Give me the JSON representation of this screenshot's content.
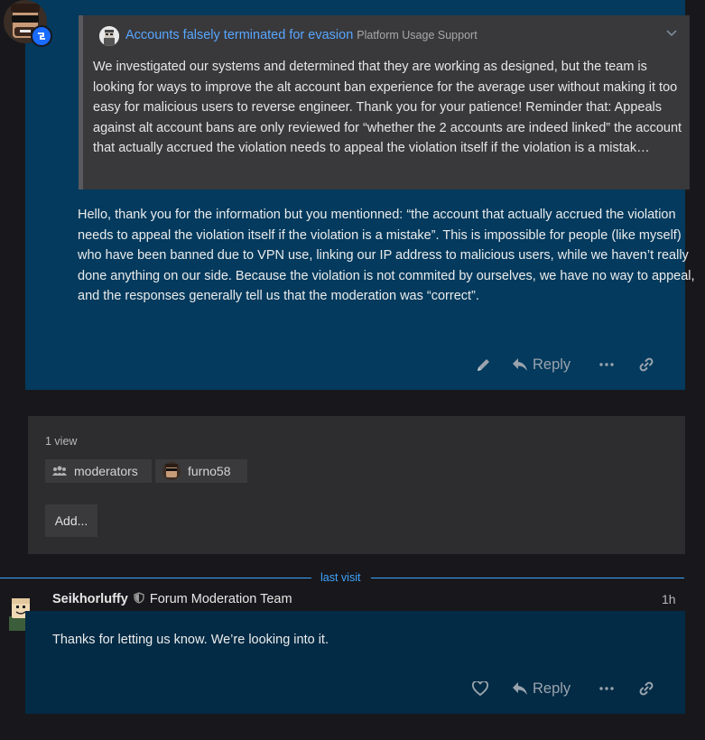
{
  "post1": {
    "quote": {
      "title": "Accounts falsely terminated for evasion",
      "category": "Platform Usage Support",
      "text": "We investigated our systems and determined that they are working as designed, but the team is looking for ways to improve the alt account ban experience for the average user without making it too easy for malicious users to reverse engineer. Thank you for your patience! Reminder that: Appeals against alt account bans are only reviewed for “whether the 2 accounts are indeed linked” the account that actually accrued the violation needs to appeal the violation itself if the violation is a mistak…"
    },
    "body": "Hello, thank you for the information but you mentionned: “the account that actually accrued the violation needs to appeal the violation itself if the violation is a mistake”. This is impossible for people (like myself) who have been banned due to VPN use, linking our IP address to malicious users, while we haven’t really done anything on our side. Because the violation is not commited by ourselves, we have no way to appeal, and the responses generally tell us that the moderation was “correct”.",
    "actions": {
      "reply_label": "Reply"
    }
  },
  "views": {
    "count": "1 view",
    "groups": [
      {
        "label": "moderators",
        "icon": "group-icon"
      },
      {
        "label": "furno58",
        "icon": "user-avatar"
      }
    ],
    "add_label": "Add..."
  },
  "last_visit": "last visit",
  "post2": {
    "author": "Seikhorluffy",
    "role": "Forum Moderation Team",
    "time": "1h",
    "body": "Thanks for letting us know. We’re looking into it.",
    "actions": {
      "reply_label": "Reply"
    }
  },
  "colors": {
    "page_bg": "#18181c",
    "post_highlight": "#033a5d",
    "post_bg": "#032b45",
    "link": "#58a6ff",
    "last_visit": "#3fa4ff"
  }
}
